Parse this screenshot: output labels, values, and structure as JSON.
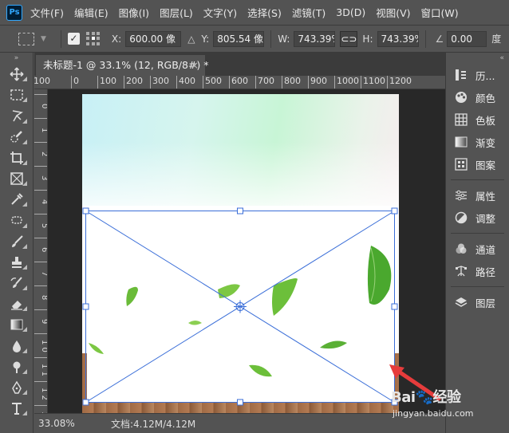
{
  "menubar": {
    "logo": "Ps",
    "items": [
      "文件(F)",
      "编辑(E)",
      "图像(I)",
      "图层(L)",
      "文字(Y)",
      "选择(S)",
      "滤镜(T)",
      "3D(D)",
      "视图(V)",
      "窗口(W)"
    ]
  },
  "options": {
    "x_label": "X:",
    "x_value": "600.00 像",
    "y_label": "Y:",
    "y_value": "805.54 像",
    "w_label": "W:",
    "w_value": "743.39%",
    "h_label": "H:",
    "h_value": "743.39%",
    "angle_value": "0.00",
    "angle_unit": "度"
  },
  "document": {
    "tab_title": "未标题-1 @ 33.1% (12, RGB/8#) *",
    "tab_close": "×",
    "ruler_h_labels": [
      "100",
      "0",
      "100",
      "200",
      "300",
      "400",
      "500",
      "600",
      "700",
      "800",
      "900",
      "1000",
      "1100",
      "1200"
    ],
    "ruler_v_labels": [
      "0",
      "1",
      "2",
      "3",
      "4",
      "5",
      "6",
      "7",
      "8",
      "9",
      "1 0",
      "1 1",
      "1 2",
      "1 3"
    ]
  },
  "status": {
    "zoom": "33.08%",
    "doc_size": "文档:4.12M/4.12M"
  },
  "panels": {
    "group1": [
      {
        "icon": "history-icon",
        "label": "历..."
      },
      {
        "icon": "color-icon",
        "label": "颜色"
      },
      {
        "icon": "swatches-icon",
        "label": "色板"
      },
      {
        "icon": "gradient-icon",
        "label": "渐变"
      },
      {
        "icon": "patterns-icon",
        "label": "图案"
      }
    ],
    "group2": [
      {
        "icon": "properties-icon",
        "label": "属性"
      },
      {
        "icon": "adjustments-icon",
        "label": "调整"
      }
    ],
    "group3": [
      {
        "icon": "channels-icon",
        "label": "通道"
      },
      {
        "icon": "paths-icon",
        "label": "路径"
      }
    ],
    "group4": [
      {
        "icon": "layers-icon",
        "label": "图层"
      }
    ]
  },
  "tools": [
    "move-tool-icon",
    "marquee-tool-icon",
    "lasso-tool-icon",
    "quick-select-tool-icon",
    "crop-tool-icon",
    "frame-tool-icon",
    "eyedropper-tool-icon",
    "healing-brush-tool-icon",
    "brush-tool-icon",
    "clone-stamp-tool-icon",
    "history-brush-tool-icon",
    "eraser-tool-icon",
    "gradient-tool-icon",
    "blur-tool-icon",
    "dodge-tool-icon",
    "pen-tool-icon",
    "type-tool-icon"
  ],
  "watermark": {
    "brand": "Bai",
    "brand2": "经验",
    "url": "jingyan.baidu.com"
  },
  "colors": {
    "ui_bg": "#535353",
    "pasteboard": "#282828",
    "transform_line": "#3a6ed8",
    "arrow": "#e63c3c"
  }
}
